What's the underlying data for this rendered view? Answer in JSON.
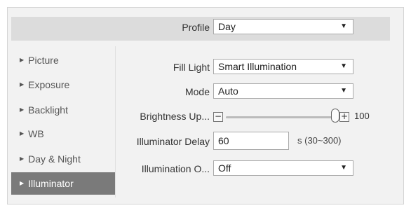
{
  "profile": {
    "label": "Profile",
    "value": "Day"
  },
  "sidebar": {
    "items": [
      {
        "label": "Picture"
      },
      {
        "label": "Exposure"
      },
      {
        "label": "Backlight"
      },
      {
        "label": "WB"
      },
      {
        "label": "Day & Night"
      },
      {
        "label": "Illuminator",
        "active": true
      }
    ]
  },
  "settings": {
    "fill_light": {
      "label": "Fill Light",
      "value": "Smart Illumination"
    },
    "mode": {
      "label": "Mode",
      "value": "Auto"
    },
    "brightness": {
      "label": "Brightness Up...",
      "value": "100",
      "min": 0,
      "max": 100
    },
    "illuminator_delay": {
      "label": "Illuminator Delay",
      "value": "60",
      "hint": "s (30~300)"
    },
    "illumination_o": {
      "label": "Illumination O...",
      "value": "Off"
    }
  },
  "icons": {
    "dropdown_arrow": "▼",
    "sidebar_arrow": "▶",
    "minus": "−",
    "plus": "+"
  },
  "colors": {
    "active_item_bg": "#7a7a7a",
    "panel_bg": "#f2f2f2",
    "header_bg": "#dcdcdc"
  }
}
